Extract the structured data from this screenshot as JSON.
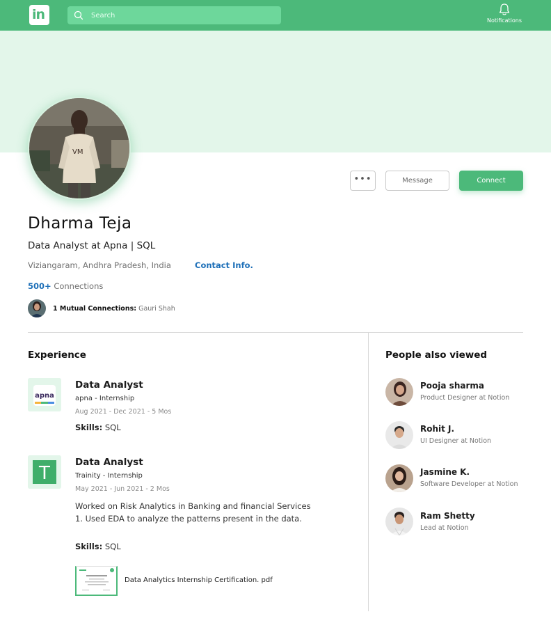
{
  "nav": {
    "logo_text": "in",
    "search_placeholder": "Search",
    "notifications_label": "Notifications"
  },
  "colors": {
    "accent": "#4cb97a",
    "link": "#1d6fb8",
    "banner": "#e3f6ea"
  },
  "actions": {
    "more_label": "•••",
    "message_label": "Message",
    "connect_label": "Connect"
  },
  "profile": {
    "name": "Dharma Teja",
    "headline": "Data Analyst at Apna | SQL",
    "location": "Viziangaram, Andhra Pradesh, India",
    "contact_label": "Contact Info.",
    "connections_count": "500+",
    "connections_label": "Connections",
    "mutual_label": "1 Mutual Connections:",
    "mutual_name": "Gauri Shah"
  },
  "experience": {
    "title": "Experience",
    "items": [
      {
        "logo_text": "apna",
        "title": "Data Analyst",
        "company": "apna  - Internship",
        "dates": "Aug 2021 - Dec 2021 - 5 Mos",
        "skills_label": "Skills:",
        "skills": "SQL"
      },
      {
        "logo_text": "T",
        "title": "Data Analyst",
        "company": "Trainity  - Internship",
        "dates": "May 2021 - Jun 2021 - 2 Mos",
        "description": "Worked on Risk Analytics in Banking and financial Services 1. Used EDA to analyze the patterns present in the data.",
        "skills_label": "Skills:",
        "skills": "SQL",
        "attachment": "Data Analytics Internship Certification. pdf"
      }
    ]
  },
  "people": {
    "title": "People also viewed",
    "items": [
      {
        "name": "Pooja sharma",
        "role": "Product Designer at Notion"
      },
      {
        "name": "Rohit J.",
        "role": "UI Designer at Notion"
      },
      {
        "name": "Jasmine K.",
        "role": "Software Developer at Notion"
      },
      {
        "name": "Ram Shetty",
        "role": "Lead at Notion"
      }
    ]
  }
}
